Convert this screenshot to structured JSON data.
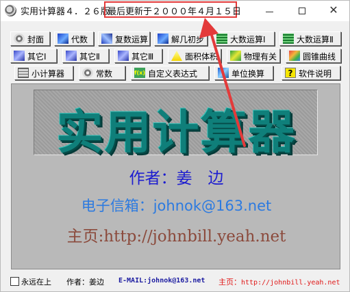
{
  "window": {
    "title": "实用计算器４．２６版",
    "update_notice": "最后更新于２０００年４月１５日",
    "controls": {
      "minimize": "—",
      "maximize": "☐",
      "close": "✕"
    }
  },
  "toolbar": {
    "rows": [
      [
        {
          "label": "封面",
          "icon": "disc-icon"
        },
        {
          "label": "代数",
          "icon": "algebra-icon"
        },
        {
          "label": "复数运算",
          "icon": "complex-icon"
        },
        {
          "label": "解几初步",
          "icon": "analytic-geometry-icon"
        },
        {
          "label": "大数运算Ⅰ",
          "icon": "bignum-icon"
        },
        {
          "label": "大数运算Ⅱ",
          "icon": "bignum-icon"
        }
      ],
      [
        {
          "label": "其它Ⅰ",
          "icon": "other-icon"
        },
        {
          "label": "其它Ⅱ",
          "icon": "other-icon"
        },
        {
          "label": "其它Ⅲ",
          "icon": "other-icon"
        },
        {
          "label": "面积体积",
          "icon": "triangle-icon"
        },
        {
          "label": "物理有关",
          "icon": "physics-icon"
        },
        {
          "label": "圆锥曲线",
          "icon": "conic-icon"
        }
      ],
      [
        {
          "label": "小计算器",
          "icon": "calculator-icon"
        },
        {
          "label": "常数",
          "icon": "disc-icon"
        },
        {
          "label": "自定义表达式",
          "icon": "fx-icon",
          "icon_text": "f(x)"
        },
        {
          "label": "单位换算",
          "icon": "unit-icon"
        },
        {
          "label": "软件说明",
          "icon": "help-icon",
          "icon_text": "?"
        }
      ]
    ]
  },
  "cover": {
    "logo": "实用计算器",
    "author": "作者：姜　边",
    "email": "电子信箱：johnok@163.net",
    "homepage": "主页:http://johnbill.yeah.net"
  },
  "status": {
    "always_on_top": "永远在上",
    "author": "作者：姜边",
    "email": "E-MAIL:johnok@163.net",
    "home_label": "主页：",
    "home_url": "http://johnbill.yeah.net"
  },
  "colors": {
    "annotation": "#e33a3a",
    "logo": "#0f7f7a",
    "author_text": "#1d1dd0",
    "email_text": "#2c7ae0",
    "home_text": "#8b4a3c",
    "panel_bg": "#b9b9b9"
  }
}
